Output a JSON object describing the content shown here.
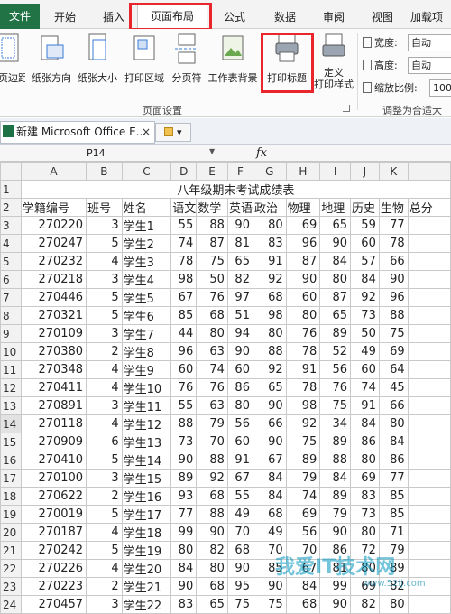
{
  "ribbon_tabs": [
    "文件",
    "开始",
    "插入",
    "页面布局",
    "公式",
    "数据",
    "审阅",
    "视图",
    "加载项"
  ],
  "ribbon_buttons": {
    "margins": "页边距",
    "orientation": "纸张方向",
    "size": "纸张大小",
    "print_area": "打印区域",
    "breaks": "分页符",
    "background": "工作表背景",
    "print_titles": "打印标题",
    "custom_line1": "定义",
    "custom_line2": "打印样式"
  },
  "groups": {
    "page_setup": "页面设置",
    "scale_to_fit": "调整为合适大"
  },
  "scale": {
    "width_label": "宽度:",
    "width_value": "自动",
    "height_label": "高度:",
    "height_value": "自动",
    "zoom_label": "缩放比例:",
    "zoom_value": "100%"
  },
  "workbook": {
    "tab_title": "新建 Microsoft Office E...",
    "close": "×"
  },
  "formula_bar": {
    "name_box": "P14",
    "fx": "fx",
    "content": ""
  },
  "columns": [
    "A",
    "B",
    "C",
    "D",
    "E",
    "F",
    "G",
    "H",
    "I",
    "J",
    "K"
  ],
  "sheet_title": "八年级期末考试成绩表",
  "headers": [
    "学籍编号",
    "班号",
    "姓名",
    "语文",
    "数学",
    "英语",
    "政治",
    "物理",
    "地理",
    "历史",
    "生物",
    "总分"
  ],
  "rows": [
    [
      "270220",
      "3",
      "学生1",
      "55",
      "88",
      "90",
      "80",
      "69",
      "65",
      "59",
      "77"
    ],
    [
      "270247",
      "5",
      "学生2",
      "74",
      "87",
      "81",
      "83",
      "96",
      "90",
      "60",
      "78"
    ],
    [
      "270232",
      "4",
      "学生3",
      "78",
      "75",
      "65",
      "91",
      "87",
      "84",
      "57",
      "66"
    ],
    [
      "270218",
      "3",
      "学生4",
      "98",
      "50",
      "82",
      "92",
      "90",
      "80",
      "84",
      "90"
    ],
    [
      "270446",
      "5",
      "学生5",
      "67",
      "76",
      "97",
      "68",
      "60",
      "87",
      "92",
      "96"
    ],
    [
      "270321",
      "5",
      "学生6",
      "85",
      "68",
      "51",
      "98",
      "80",
      "65",
      "73",
      "88"
    ],
    [
      "270109",
      "3",
      "学生7",
      "44",
      "80",
      "94",
      "80",
      "76",
      "89",
      "50",
      "75"
    ],
    [
      "270380",
      "2",
      "学生8",
      "96",
      "63",
      "90",
      "88",
      "78",
      "52",
      "49",
      "69"
    ],
    [
      "270348",
      "4",
      "学生9",
      "60",
      "74",
      "60",
      "92",
      "91",
      "56",
      "60",
      "64"
    ],
    [
      "270411",
      "4",
      "学生10",
      "76",
      "76",
      "86",
      "65",
      "78",
      "76",
      "74",
      "45"
    ],
    [
      "270891",
      "3",
      "学生11",
      "55",
      "63",
      "80",
      "90",
      "98",
      "75",
      "91",
      "66"
    ],
    [
      "270118",
      "4",
      "学生12",
      "88",
      "79",
      "56",
      "66",
      "92",
      "34",
      "84",
      "80"
    ],
    [
      "270909",
      "6",
      "学生13",
      "73",
      "70",
      "60",
      "90",
      "75",
      "89",
      "86",
      "84"
    ],
    [
      "270410",
      "5",
      "学生14",
      "90",
      "88",
      "91",
      "67",
      "89",
      "88",
      "80",
      "86"
    ],
    [
      "270100",
      "3",
      "学生15",
      "89",
      "92",
      "67",
      "84",
      "79",
      "84",
      "69",
      "77"
    ],
    [
      "270622",
      "2",
      "学生16",
      "93",
      "68",
      "55",
      "84",
      "74",
      "89",
      "83",
      "85"
    ],
    [
      "270019",
      "5",
      "学生17",
      "77",
      "88",
      "49",
      "68",
      "69",
      "79",
      "73",
      "85"
    ],
    [
      "270187",
      "4",
      "学生18",
      "99",
      "90",
      "70",
      "49",
      "56",
      "90",
      "80",
      "71"
    ],
    [
      "270242",
      "5",
      "学生19",
      "80",
      "82",
      "68",
      "70",
      "70",
      "86",
      "72",
      "79"
    ],
    [
      "270226",
      "4",
      "学生20",
      "84",
      "80",
      "90",
      "85",
      "67",
      "81",
      "80",
      "89"
    ],
    [
      "270223",
      "2",
      "学生21",
      "90",
      "68",
      "95",
      "90",
      "84",
      "99",
      "69",
      "82"
    ],
    [
      "270457",
      "3",
      "学生22",
      "83",
      "65",
      "75",
      "75",
      "68",
      "90",
      "82",
      "80"
    ]
  ],
  "selected_row": 14,
  "watermark": "我爱IT技术网",
  "watermark_url": "www.52ij.com"
}
